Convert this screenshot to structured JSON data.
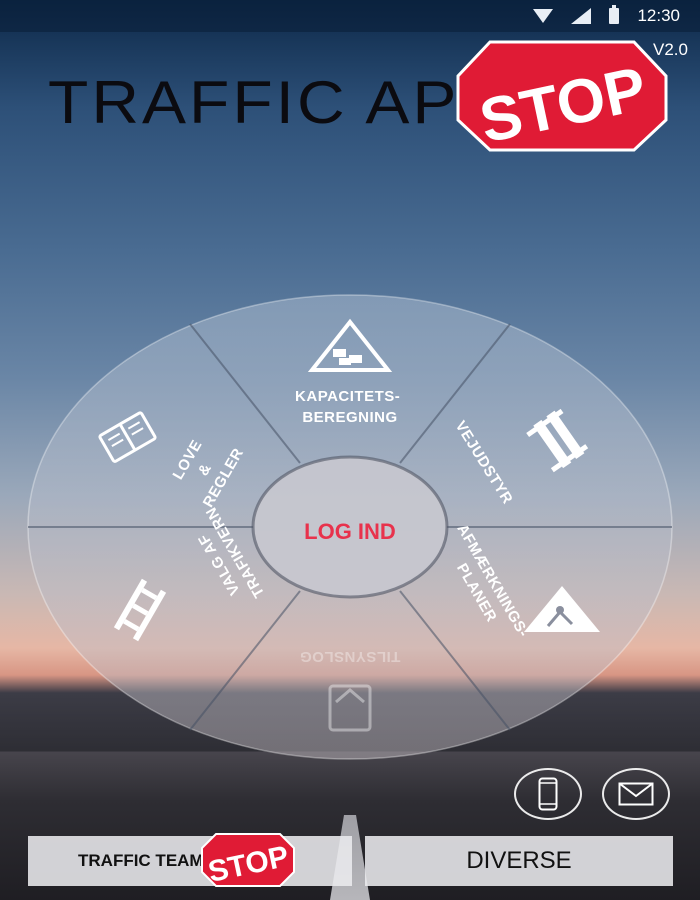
{
  "status_bar": {
    "time": "12:30",
    "icons": [
      "wifi-icon",
      "cell-signal-icon",
      "battery-icon"
    ]
  },
  "app": {
    "title": "TRAFFIC APP",
    "version": "V2.0",
    "logo_text": "STOP"
  },
  "wheel": {
    "center_label": "LOG IND",
    "segments": [
      {
        "id": "kapacitet",
        "lines": [
          "KAPACITETS-",
          "BEREGNING"
        ],
        "icon": "traffic-jam-triangle-icon"
      },
      {
        "id": "vejudstyr",
        "lines": [
          "VEJUDSTYR"
        ],
        "icon": "road-barrier-icon"
      },
      {
        "id": "afmaerkning",
        "lines": [
          "AFMÆRKNINGS-",
          "PLANER"
        ],
        "icon": "roadwork-sign-icon"
      },
      {
        "id": "tilsynslog",
        "lines": [
          "TILSYNSLOG"
        ],
        "icon": "clipboard-icon"
      },
      {
        "id": "trafikvern",
        "lines": [
          "VALG AF",
          "TRAFIKVERN"
        ],
        "icon": "guardrail-icon"
      },
      {
        "id": "love",
        "lines": [
          "LOVE",
          "&",
          "REGLER"
        ],
        "icon": "law-book-icon"
      }
    ]
  },
  "actions": {
    "phone_icon": "phone-icon",
    "mail_icon": "mail-icon"
  },
  "bottom": {
    "team_label": "TRAFFIC TEAM",
    "team_logo": "STOP",
    "diverse_label": "DIVERSE"
  },
  "colors": {
    "accent_red": "#e8324c",
    "stop_red": "#e01b35"
  }
}
